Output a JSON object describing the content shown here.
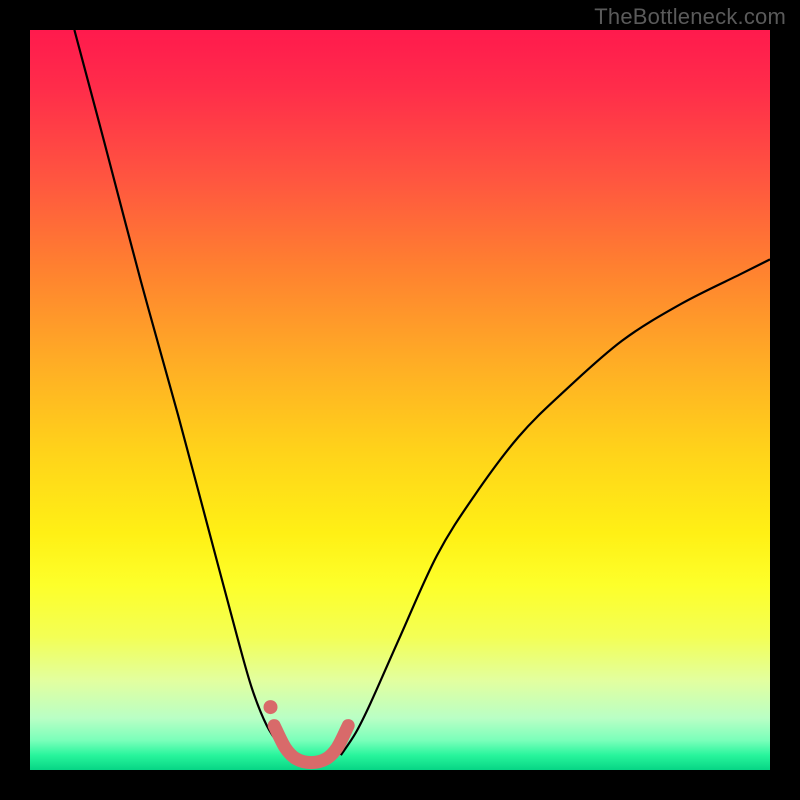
{
  "watermark": {
    "text": "TheBottleneck.com"
  },
  "chart_data": {
    "type": "line",
    "title": "",
    "xlabel": "",
    "ylabel": "",
    "xlim": [
      0,
      100
    ],
    "ylim": [
      0,
      100
    ],
    "series": [
      {
        "name": "left-branch",
        "x": [
          6,
          10,
          15,
          20,
          24,
          28,
          30,
          32,
          34,
          35
        ],
        "values": [
          100,
          85,
          66,
          48,
          33,
          18,
          11,
          6,
          3,
          2
        ]
      },
      {
        "name": "right-branch",
        "x": [
          42,
          44,
          46,
          50,
          55,
          60,
          66,
          72,
          80,
          88,
          96,
          100
        ],
        "values": [
          2,
          5,
          9,
          18,
          29,
          37,
          45,
          51,
          58,
          63,
          67,
          69
        ]
      },
      {
        "name": "valley-highlight",
        "x": [
          33,
          34.5,
          36,
          38,
          40,
          41.5,
          43
        ],
        "values": [
          6,
          3,
          1.5,
          1,
          1.5,
          3,
          6
        ]
      },
      {
        "name": "highlight-dot",
        "x": [
          32.5
        ],
        "values": [
          8.5
        ]
      }
    ],
    "colors": {
      "curve": "#000000",
      "highlight": "#d86a6a"
    }
  }
}
